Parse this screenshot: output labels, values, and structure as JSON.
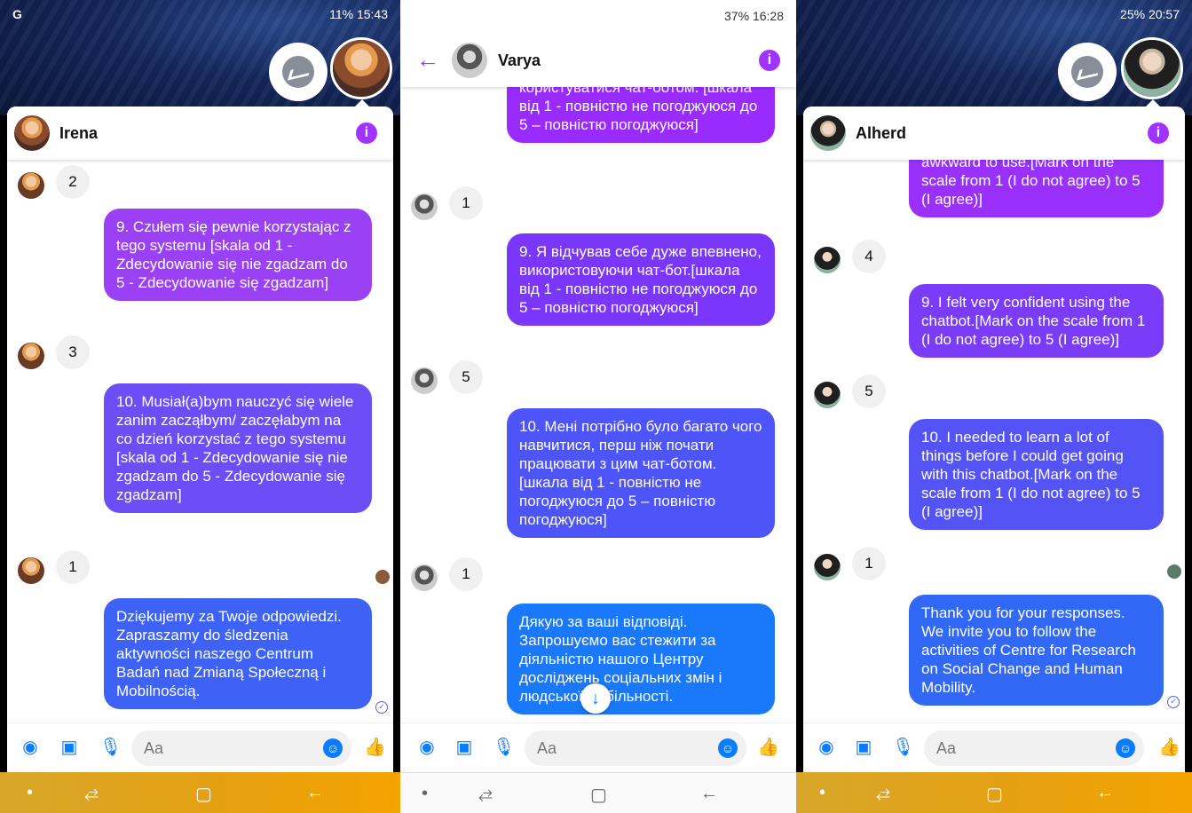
{
  "phones": [
    {
      "status": {
        "left": "G",
        "right": "11% 15:43"
      },
      "contact": "Irena",
      "colors": {
        "top": "#a24df3",
        "bottom": "#3f5ef5"
      },
      "messages": {
        "reply_a": "2",
        "q9": "9. Czułem się pewnie korzystając z tego systemu [skala od 1 - Zdecydowanie się nie zgadzam do 5 - Zdecydowanie się zgadzam]",
        "reply_b": "3",
        "q10": "10. Musiał(a)bym nauczyć się wiele zanim zacząłbym/ zaczęłabym na co dzień korzystać z tego systemu [skala od 1 - Zdecydowanie się nie zgadzam do 5 - Zdecydowanie się zgadzam]",
        "reply_c": "1",
        "thanks": "Dziękujemy za Twoje odpowiedzi. Zapraszamy do śledzenia aktywności naszego Centrum Badań nad Zmianą Społeczną i Mobilnością."
      },
      "composer_placeholder": "Aa"
    },
    {
      "status": {
        "left": "",
        "right": "37% 16:28"
      },
      "contact": "Varya",
      "messages": {
        "top_partial": "користуватися чат-ботом. [шкала від 1 - повністю не погоджуюся до 5 – повністю погоджуюся]",
        "reply_a": "1",
        "q9": "9. Я відчував себе дуже впевнено, використовуючи чат-бот.[шкала від 1 - повністю не погоджуюся до 5 – повністю погоджуюся]",
        "reply_b": "5",
        "q10": "10. Мені потрібно було багато чого навчитися, перш ніж почати працювати з цим чат-ботом.[шкала від 1 - повністю не погоджуюся до 5 – повністю погоджуюся]",
        "reply_c": "1",
        "thanks": "Дякую за ваші відповіді. Запрошуємо вас стежити за діяльністю нашого Центру досліджень соціальних змін і людської мобільності."
      },
      "composer_placeholder": "Aa"
    },
    {
      "status": {
        "left": "",
        "right": "25% 20:57"
      },
      "contact": "Alherd",
      "messages": {
        "top_partial": "awkward to use.[Mark on the scale from 1 (I do not agree) to 5 (I agree)]",
        "reply_a": "4",
        "q9": "9. I felt very confident using the chatbot.[Mark on the scale from 1 (I do not agree) to 5 (I agree)]",
        "reply_b": "5",
        "q10": "10. I needed to learn a lot of things before I could get going with this chatbot.[Mark on the scale from 1 (I do not agree) to 5 (I agree)]",
        "reply_c": "1",
        "thanks": "Thank you for your responses. We invite you to follow the activities of Centre for Research on Social Change and Human Mobility."
      },
      "composer_placeholder": "Aa"
    }
  ],
  "icons": {
    "back": "←",
    "info": "i",
    "camera": "◉",
    "image": "▣",
    "mic": "🎙",
    "emoji": "☺",
    "like": "👍",
    "scroll_down": "↓",
    "nav_dot": "•",
    "nav_recent": "⥄",
    "nav_home": "▢",
    "nav_back": "←"
  },
  "brand": {
    "accent": "#a033ff",
    "messenger_blue": "#0a7cff"
  }
}
